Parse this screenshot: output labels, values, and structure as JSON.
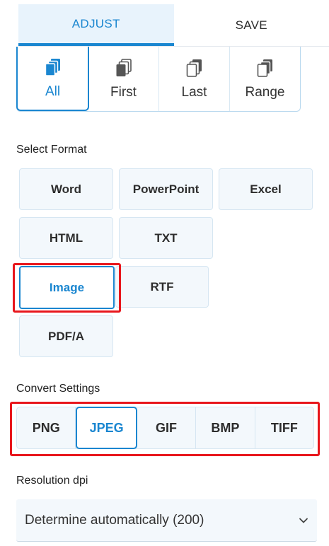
{
  "tabs": [
    {
      "label": "ADJUST",
      "active": true
    },
    {
      "label": "SAVE",
      "active": false
    }
  ],
  "pages": {
    "options": [
      {
        "label": "All",
        "icon": "multi-page-icon",
        "selected": true
      },
      {
        "label": "First",
        "icon": "first-page-icon",
        "selected": false
      },
      {
        "label": "Last",
        "icon": "last-page-icon",
        "selected": false
      },
      {
        "label": "Range",
        "icon": "range-pages-icon",
        "selected": false
      }
    ]
  },
  "format": {
    "label": "Select Format",
    "options": [
      "Word",
      "PowerPoint",
      "Excel",
      "HTML",
      "TXT",
      "Image",
      "RTF",
      "PDF/A"
    ],
    "selected": "Image"
  },
  "convert": {
    "label": "Convert Settings",
    "options": [
      "PNG",
      "JPEG",
      "GIF",
      "BMP",
      "TIFF"
    ],
    "selected": "JPEG"
  },
  "resolution": {
    "label": "Resolution dpi",
    "value": "Determine automatically (200)"
  },
  "colors": {
    "accent": "#1a86d0",
    "highlight": "#e8161c",
    "button_bg": "#f3f8fc"
  }
}
